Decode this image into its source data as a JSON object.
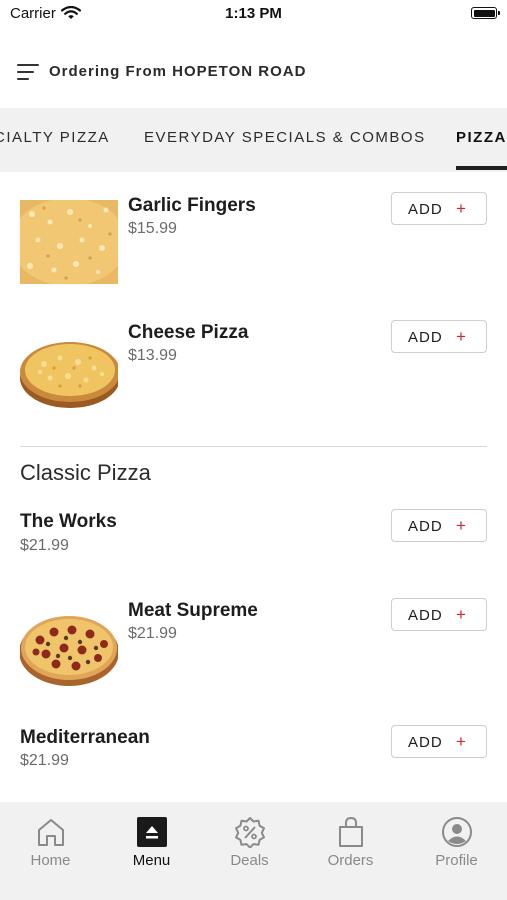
{
  "status_bar": {
    "carrier": "Carrier",
    "time": "1:13 PM"
  },
  "header": {
    "title": "Ordering From HOPETON ROAD",
    "icon": "filter-lines-icon"
  },
  "tabs": [
    {
      "label": "CIALTY PIZZA",
      "active": false
    },
    {
      "label": "EVERYDAY SPECIALS & COMBOS",
      "active": false
    },
    {
      "label": "PIZZA",
      "active": true
    }
  ],
  "menu": {
    "items": [
      {
        "name": "Garlic Fingers",
        "price": "$15.99",
        "add_label": "ADD",
        "add_icon": "+"
      },
      {
        "name": "Cheese Pizza",
        "price": "$13.99",
        "add_label": "ADD",
        "add_icon": "+"
      }
    ],
    "section": {
      "title": "Classic Pizza",
      "items": [
        {
          "name": "The Works",
          "price": "$21.99",
          "add_label": "ADD",
          "add_icon": "+"
        },
        {
          "name": "Meat Supreme",
          "price": "$21.99",
          "add_label": "ADD",
          "add_icon": "+"
        },
        {
          "name": "Mediterranean",
          "price": "$21.99",
          "add_label": "ADD",
          "add_icon": "+"
        }
      ]
    }
  },
  "bottom_nav": [
    {
      "label": "Home",
      "icon": "home-icon",
      "active": false
    },
    {
      "label": "Menu",
      "icon": "menu-icon",
      "active": true
    },
    {
      "label": "Deals",
      "icon": "deals-icon",
      "active": false
    },
    {
      "label": "Orders",
      "icon": "orders-bag-icon",
      "active": false
    },
    {
      "label": "Profile",
      "icon": "profile-icon",
      "active": false
    }
  ],
  "colors": {
    "accent": "#d3262f",
    "tab_bar_bg": "#f1f1f2",
    "nav_bg": "#f1f1f2",
    "active_text": "#111111",
    "inactive_text": "#8a8a8a"
  }
}
